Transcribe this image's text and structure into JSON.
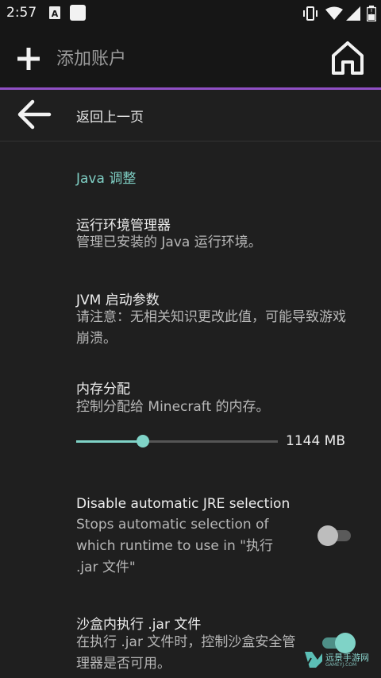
{
  "status_bar": {
    "time": "2:57",
    "icons": [
      "font-a-icon",
      "square-icon",
      "vibrate-icon",
      "wifi-icon",
      "signal-icon",
      "battery-icon"
    ]
  },
  "app_bar": {
    "title": "添加账户",
    "add_icon": "plus-icon",
    "home_icon": "home-icon",
    "accent_color": "#8f4fc4"
  },
  "back_row": {
    "label": "返回上一页",
    "icon": "arrow-left-icon"
  },
  "section": {
    "title": "Java 调整",
    "accent_color": "#7fcfc4"
  },
  "preferences": [
    {
      "title": "运行环境管理器",
      "summary": "管理已安装的 Java 运行环境。"
    },
    {
      "title": "JVM 启动参数",
      "summary": "请注意：无相关知识更改此值，可能导致游戏崩溃。"
    },
    {
      "title": "内存分配",
      "summary": "控制分配给 Minecraft 的内存。",
      "slider": {
        "value_text": "1144 MB",
        "fill_fraction": 0.33
      }
    },
    {
      "title": "Disable automatic JRE selection",
      "summary": "Stops automatic selection of which runtime to use in \"执行 .jar 文件\"",
      "switch_state": "off"
    },
    {
      "title": "沙盒内执行 .jar 文件",
      "summary": "在执行 .jar 文件时，控制沙盒安全管理器是否可用。",
      "switch_state": "on"
    }
  ],
  "watermark": {
    "text": "远景手游网",
    "sub": "GAMEYJ.COM"
  }
}
